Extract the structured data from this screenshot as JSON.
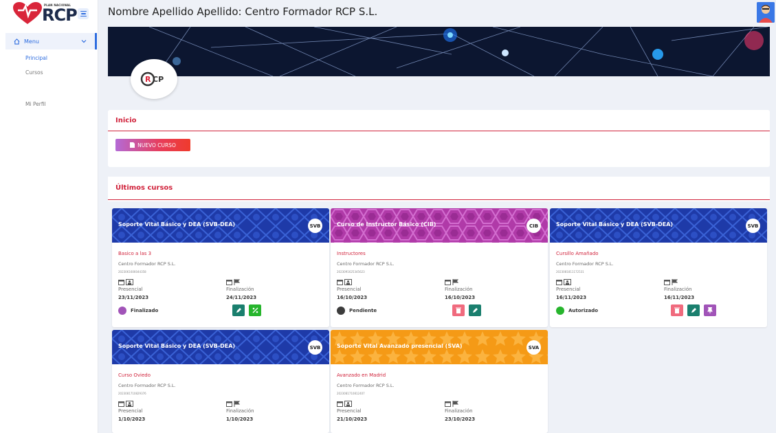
{
  "logo": {
    "small": "PLAN NACIONAL",
    "big": "RCP"
  },
  "header": {
    "title": "Nombre Apellido Apellido: Centro Formador RCP S.L."
  },
  "sidebar": {
    "menu_label": "Menu",
    "items": [
      {
        "label": "Principal"
      },
      {
        "label": "Cursos"
      },
      {
        "label": "Mi Perfil"
      }
    ]
  },
  "inicio": {
    "title": "Inicio",
    "new_course": "NUEVO CURSO"
  },
  "ultimos": {
    "title": "Últimos cursos"
  },
  "colors": {
    "accent": "#d0213a",
    "primary": "#2d6cdf",
    "teal": "#1a7f6e",
    "green": "#27b52d",
    "pink": "#f06b7e",
    "purple": "#a154b8"
  },
  "cards": [
    {
      "title": "Soporte Vital Básico y DEA (SVB-DEA)",
      "badge": "SVB",
      "name": "Basico a las 3",
      "org": "Centro Formador RCP S.L.",
      "code": "2023061606044358",
      "lbl_start": "Presencial",
      "lbl_end": "Finalización",
      "start": "23/11/2023",
      "end": "24/11/2023",
      "status": "Finalizado"
    },
    {
      "title": "Curso de Instructor Básico (CIB)",
      "badge": "CIB",
      "name": "Instructores",
      "org": "Centro Formador RCP S.L.",
      "code": "2023091625345623",
      "lbl_start": "Presencial",
      "lbl_end": "Finalización",
      "start": "16/10/2023",
      "end": "16/10/2023",
      "status": "Pendiente"
    },
    {
      "title": "Soporte Vital Básico y DEA (SVB-DEA)",
      "badge": "SVB",
      "name": "Cursillo Amañado",
      "org": "Centro Formador RCP S.L.",
      "code": "2023081811172531",
      "lbl_start": "Presencial",
      "lbl_end": "Finalización",
      "start": "16/11/2023",
      "end": "16/11/2023",
      "status": "Autorizado"
    },
    {
      "title": "Soporte Vital Básico y DEA (SVB-DEA)",
      "badge": "SVB",
      "name": "Curso Oviedo",
      "org": "Centro Formador RCP S.L.",
      "code": "2023081710829376",
      "lbl_start": "Presencial",
      "lbl_end": "Finalización",
      "start": "1/10/2023",
      "end": "1/10/2023"
    },
    {
      "title": "Soporte Vital Avanzado presencial (SVA)",
      "badge": "SVA",
      "name": "Avanzado en Madrid",
      "org": "Centro Formador RCP S.L.",
      "code": "2023081710812407",
      "lbl_start": "Presencial",
      "lbl_end": "Finalización",
      "start": "21/10/2023",
      "end": "23/10/2023"
    }
  ]
}
